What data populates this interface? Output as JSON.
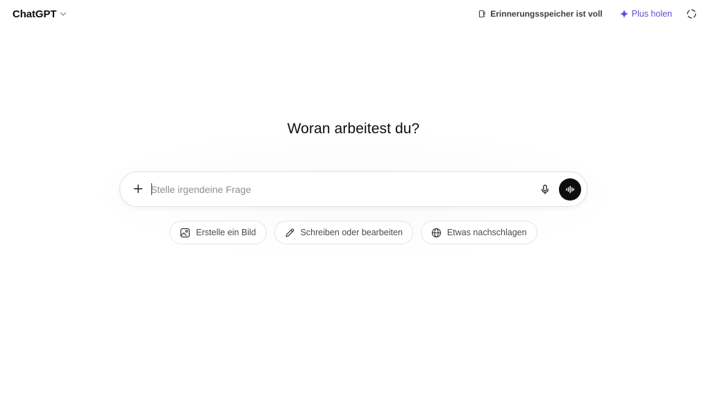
{
  "header": {
    "model_name": "ChatGPT",
    "model_icon": "chevron-down-icon",
    "memory_notice": "Erinnerungsspeicher ist voll",
    "memory_icon": "memory-full-icon",
    "plus_label": "Plus holen",
    "plus_icon": "sparkle-icon",
    "temp_chat_icon": "temporary-chat-icon"
  },
  "main": {
    "headline": "Woran arbeitest du?",
    "composer": {
      "value": "",
      "placeholder": "Stelle irgendeine Frage",
      "attach_icon": "plus-icon",
      "mic_icon": "microphone-icon",
      "voice_icon": "voice-waveform-icon"
    },
    "suggestions": [
      {
        "label": "Erstelle ein Bild",
        "icon": "image-icon"
      },
      {
        "label": "Schreiben oder bearbeiten",
        "icon": "pencil-icon"
      },
      {
        "label": "Etwas nachschlagen",
        "icon": "globe-icon"
      }
    ]
  },
  "colors": {
    "accent": "#5d4fd6",
    "text": "#0d0d0d",
    "placeholder": "#8f8f8f",
    "border": "#e3e3e3",
    "voice_button": "#0d0d0d"
  }
}
